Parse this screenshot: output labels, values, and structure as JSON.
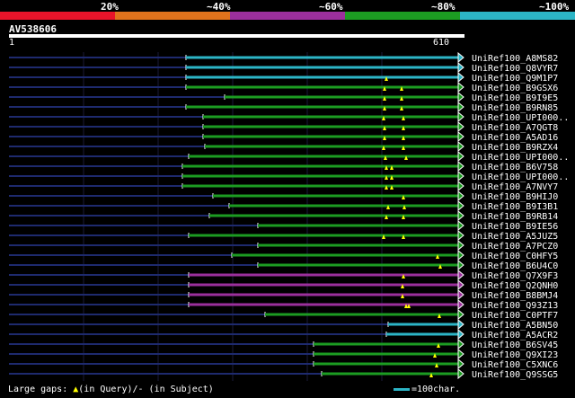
{
  "legend": {
    "segments": [
      {
        "label": "",
        "color": "#e8142a"
      },
      {
        "label": "20%",
        "color": "#e8142a"
      },
      {
        "label": "~40%",
        "color": "#e0731c"
      },
      {
        "label": "~60%",
        "color": "#9b2f9c"
      },
      {
        "label": "~80%",
        "color": "#1c9c22"
      },
      {
        "label": "~100%",
        "color": "#2cb5c6"
      }
    ]
  },
  "query": {
    "id": "AV538606",
    "start": "1",
    "end": "610"
  },
  "hits": [
    {
      "name": "UniRef100_A8MS82",
      "color": "#2cb5c6",
      "start": 207,
      "gaps": []
    },
    {
      "name": "UniRef100_Q8VYR7",
      "color": "#2cb5c6",
      "start": 207,
      "gaps": []
    },
    {
      "name": "UniRef100_Q9M1P7",
      "color": "#2cb5c6",
      "start": 207,
      "gaps": [
        430
      ]
    },
    {
      "name": "UniRef100_B9GSX6",
      "color": "#1c9c22",
      "start": 207,
      "gaps": [
        428,
        447
      ]
    },
    {
      "name": "UniRef100_B9I9E5",
      "color": "#1c9c22",
      "start": 250,
      "gaps": [
        428,
        447
      ]
    },
    {
      "name": "UniRef100_B9RN85",
      "color": "#1c9c22",
      "start": 207,
      "gaps": [
        428,
        447
      ]
    },
    {
      "name": "UniRef100_UPI000..",
      "color": "#1c9c22",
      "start": 226,
      "gaps": [
        427,
        449
      ]
    },
    {
      "name": "UniRef100_A7QGT8",
      "color": "#1c9c22",
      "start": 226,
      "gaps": [
        428,
        449
      ]
    },
    {
      "name": "UniRef100_A5AD16",
      "color": "#1c9c22",
      "start": 226,
      "gaps": [
        428,
        449
      ]
    },
    {
      "name": "UniRef100_B9RZX4",
      "color": "#1c9c22",
      "start": 228,
      "gaps": [
        427,
        449
      ]
    },
    {
      "name": "UniRef100_UPI000..",
      "color": "#1c9c22",
      "start": 210,
      "gaps": [
        429,
        452
      ]
    },
    {
      "name": "UniRef100_B6V758",
      "color": "#1c9c22",
      "start": 203,
      "gaps": [
        430,
        436
      ]
    },
    {
      "name": "UniRef100_UPI000..",
      "color": "#1c9c22",
      "start": 203,
      "gaps": [
        430,
        436
      ]
    },
    {
      "name": "UniRef100_A7NVY7",
      "color": "#1c9c22",
      "start": 203,
      "gaps": [
        430,
        436
      ]
    },
    {
      "name": "UniRef100_B9HIJ0",
      "color": "#1c9c22",
      "start": 237,
      "gaps": [
        449
      ]
    },
    {
      "name": "UniRef100_B9I3B1",
      "color": "#1c9c22",
      "start": 255,
      "gaps": [
        432,
        450
      ]
    },
    {
      "name": "UniRef100_B9RB14",
      "color": "#1c9c22",
      "start": 233,
      "gaps": [
        430,
        449
      ]
    },
    {
      "name": "UniRef100_B9IE56",
      "color": "#1c9c22",
      "start": 287,
      "gaps": []
    },
    {
      "name": "UniRef100_A5JUZ5",
      "color": "#1c9c22",
      "start": 210,
      "gaps": [
        427,
        449
      ]
    },
    {
      "name": "UniRef100_A7PCZ0",
      "color": "#1c9c22",
      "start": 287,
      "gaps": []
    },
    {
      "name": "UniRef100_C0HFY5",
      "color": "#1c9c22",
      "start": 258,
      "gaps": [
        487
      ]
    },
    {
      "name": "UniRef100_B6U4C0",
      "color": "#1c9c22",
      "start": 287,
      "gaps": [
        490
      ]
    },
    {
      "name": "UniRef100_Q7X9F3",
      "color": "#9b2f9c",
      "start": 210,
      "gaps": [
        449
      ]
    },
    {
      "name": "UniRef100_Q2QNH0",
      "color": "#9b2f9c",
      "start": 210,
      "gaps": [
        448
      ]
    },
    {
      "name": "UniRef100_B8BMJ4",
      "color": "#9b2f9c",
      "start": 210,
      "gaps": [
        448
      ]
    },
    {
      "name": "UniRef100_Q93Z13",
      "color": "#9b2f9c",
      "start": 210,
      "gaps": [
        452,
        455
      ]
    },
    {
      "name": "UniRef100_C0PTF7",
      "color": "#1c9c22",
      "start": 295,
      "gaps": [
        489
      ]
    },
    {
      "name": "UniRef100_A5BN50",
      "color": "#2cb5c6",
      "start": 432,
      "gaps": []
    },
    {
      "name": "UniRef100_A5ACR2",
      "color": "#2cb5c6",
      "start": 430,
      "gaps": []
    },
    {
      "name": "UniRef100_B6SV45",
      "color": "#1c9c22",
      "start": 349,
      "gaps": [
        488
      ]
    },
    {
      "name": "UniRef100_Q9XI23",
      "color": "#1c9c22",
      "start": 349,
      "gaps": [
        484
      ]
    },
    {
      "name": "UniRef100_C5XNC6",
      "color": "#1c9c22",
      "start": 349,
      "gaps": [
        486
      ]
    },
    {
      "name": "UniRef100_Q9SSG5",
      "color": "#1c9c22",
      "start": 358,
      "gaps": [
        480
      ]
    }
  ],
  "footer": {
    "gaps_prefix": "Large gaps: ",
    "gaps_query": "(in Query)/",
    "gaps_subject": "- (in Subject)",
    "scale_text": "=100char."
  }
}
